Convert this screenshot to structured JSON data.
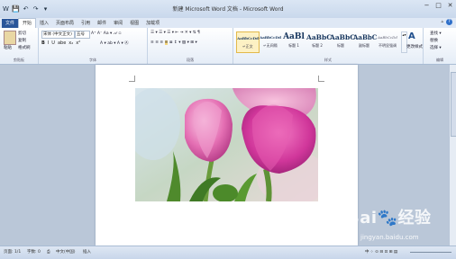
{
  "window": {
    "title": "新建 Microsoft Word 文档 - Microsoft Word",
    "controls": [
      "−",
      "□",
      "✕"
    ]
  },
  "qat": {
    "items": [
      "W",
      "💾",
      "↶",
      "↷",
      "▾"
    ]
  },
  "tabs": [
    {
      "label": "文件",
      "kind": "file"
    },
    {
      "label": "开始",
      "kind": "active"
    },
    {
      "label": "插入",
      "kind": ""
    },
    {
      "label": "页面布局",
      "kind": ""
    },
    {
      "label": "引用",
      "kind": ""
    },
    {
      "label": "邮件",
      "kind": ""
    },
    {
      "label": "审阅",
      "kind": ""
    },
    {
      "label": "视图",
      "kind": ""
    },
    {
      "label": "加载项",
      "kind": ""
    }
  ],
  "ribbon": {
    "clipboard": {
      "paste": "粘贴",
      "cut": "剪切",
      "copy": "复制",
      "format_painter": "格式刷",
      "label": "剪贴板"
    },
    "font": {
      "font_name": "宋体 (中文正文)",
      "font_size": "五号",
      "label": "字体",
      "format_buttons": [
        "B",
        "I",
        "U",
        "abe",
        "x₂",
        "x²"
      ]
    },
    "paragraph": {
      "label": "段落"
    },
    "styles": {
      "label": "样式",
      "items": [
        {
          "sample": "AaBbCcDd",
          "name": "↵正文"
        },
        {
          "sample": "AaBbCcDd",
          "name": "↵无间隔"
        },
        {
          "sample": "AaBl",
          "name": "标题 1"
        },
        {
          "sample": "AaBbC",
          "name": "标题 2"
        },
        {
          "sample": "AaBbC",
          "name": "标题"
        },
        {
          "sample": "AaBbC",
          "name": "副标题"
        },
        {
          "sample": "AaBbCcDd",
          "name": "不明显强调"
        }
      ],
      "change_styles": "更改样式"
    },
    "editing": {
      "label": "编辑",
      "find": "查找 ▾",
      "replace": "替换",
      "select": "选择 ▾"
    }
  },
  "statusbar": {
    "page": "页面: 1/1",
    "words": "字数: 0",
    "language": "中文(中国)",
    "mode": "插入"
  },
  "watermark": {
    "brand": "Bai 经验",
    "url": "jingyan.baidu.com"
  },
  "colors": {
    "file_tab": "#2a5699",
    "ribbon_bg": "#e5edf7",
    "doc_bg": "#bac7d8"
  }
}
